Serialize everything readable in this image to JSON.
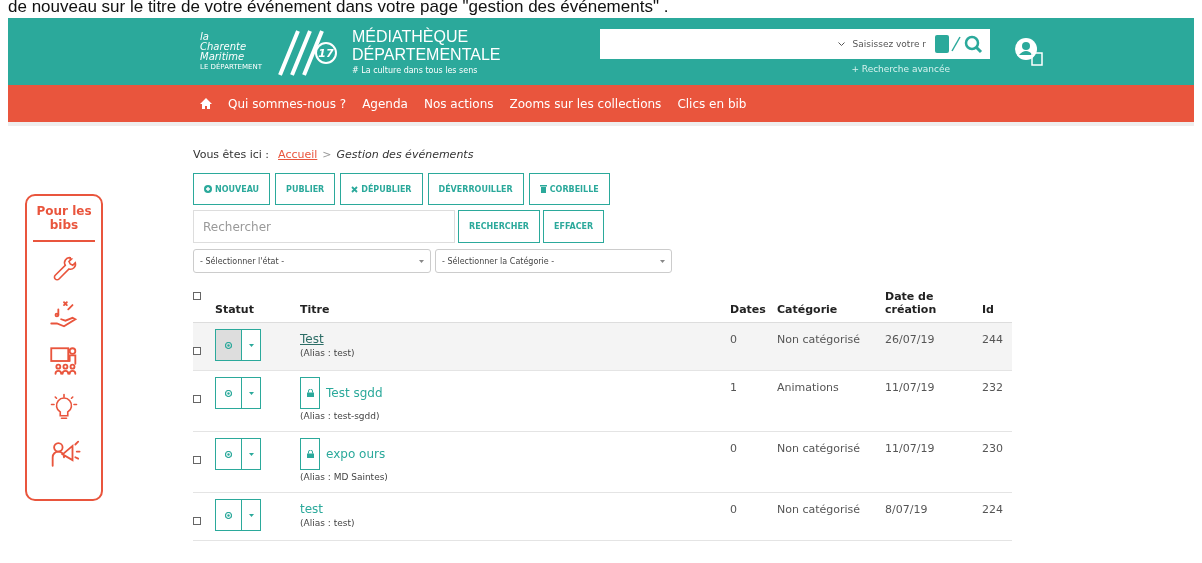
{
  "caption": "de nouveau sur le titre de votre événement dans votre page \"gestion des événements\" .",
  "header": {
    "brand_region": [
      "la",
      "Charente",
      "Maritime",
      "LE DÉPARTEMENT"
    ],
    "logo_text": "17",
    "title": [
      "MÉDIATHÈQUE",
      "DÉPARTEMENTALE"
    ],
    "tagline": "# La culture dans tous les sens",
    "search_placeholder": "Saisissez votre r",
    "advanced_link": "+ Recherche avancée"
  },
  "nav": [
    "Qui sommes-nous ?",
    "Agenda",
    "Nos actions",
    "Zooms sur les collections",
    "Clics en bib"
  ],
  "sidebar": {
    "title": "Pour les bibs"
  },
  "breadcrumb": {
    "label": "Vous êtes ici :",
    "link": "Accueil",
    "separator": ">",
    "current": "Gestion des événements"
  },
  "toolbar": [
    {
      "label": "NOUVEAU",
      "kind": "plus"
    },
    {
      "label": "PUBLIER",
      "kind": "plain"
    },
    {
      "label": "DÉPUBLIER",
      "kind": "cross"
    },
    {
      "label": "DÉVERROUILLER",
      "kind": "plain"
    },
    {
      "label": "CORBEILLE",
      "kind": "trash"
    }
  ],
  "search": {
    "placeholder": "Rechercher",
    "buttons": [
      "RECHERCHER",
      "EFFACER"
    ]
  },
  "filters": [
    "- Sélectionner l'état -",
    "- Sélectionner la Catégorie -"
  ],
  "table": {
    "select_all_checked": false,
    "columns": [
      "Statut",
      "Titre",
      "Dates",
      "Catégorie",
      "Date de création",
      "Id"
    ],
    "rows": [
      {
        "title": "Test",
        "alias": "(Alias : test)",
        "dates": "0",
        "category": "Non catégorisé",
        "created": "26/07/19",
        "id": "244",
        "hovered": true,
        "locked": false,
        "checked": false
      },
      {
        "title": "Test sgdd",
        "alias": "(Alias : test-sgdd)",
        "dates": "1",
        "category": "Animations",
        "created": "11/07/19",
        "id": "232",
        "hovered": false,
        "locked": true,
        "checked": false
      },
      {
        "title": "expo ours",
        "alias": "(Alias : MD Saintes)",
        "dates": "0",
        "category": "Non catégorisé",
        "created": "11/07/19",
        "id": "230",
        "hovered": false,
        "locked": true,
        "checked": false
      },
      {
        "title": "test",
        "alias": "(Alias : test)",
        "dates": "0",
        "category": "Non catégorisé",
        "created": "8/07/19",
        "id": "224",
        "hovered": false,
        "locked": false,
        "checked": false
      }
    ]
  }
}
